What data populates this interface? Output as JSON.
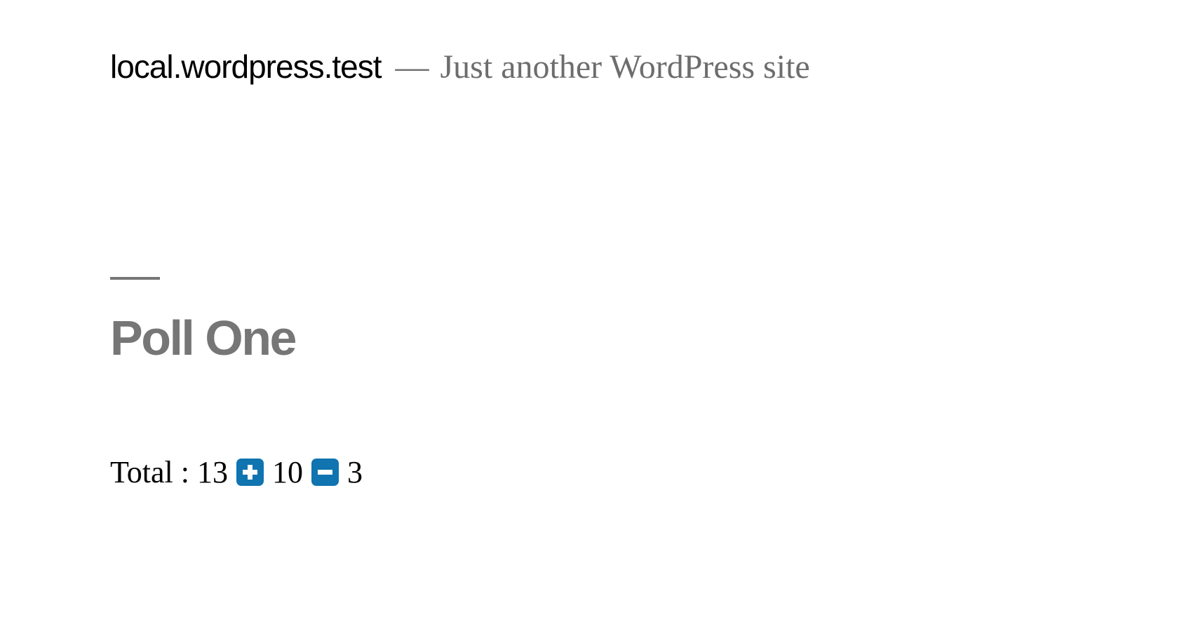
{
  "header": {
    "site_title": "local.wordpress.test",
    "separator": "—",
    "tagline": "Just another WordPress site"
  },
  "post": {
    "title": "Poll One"
  },
  "poll": {
    "total_label": "Total :",
    "total_value": "13",
    "upvote_count": "10",
    "downvote_count": "3",
    "upvote_icon": "plus-square-icon",
    "downvote_icon": "minus-square-icon"
  },
  "colors": {
    "vote_button": "#0f74b0",
    "title_gray": "#767676",
    "tagline_gray": "#6d6d6d"
  }
}
